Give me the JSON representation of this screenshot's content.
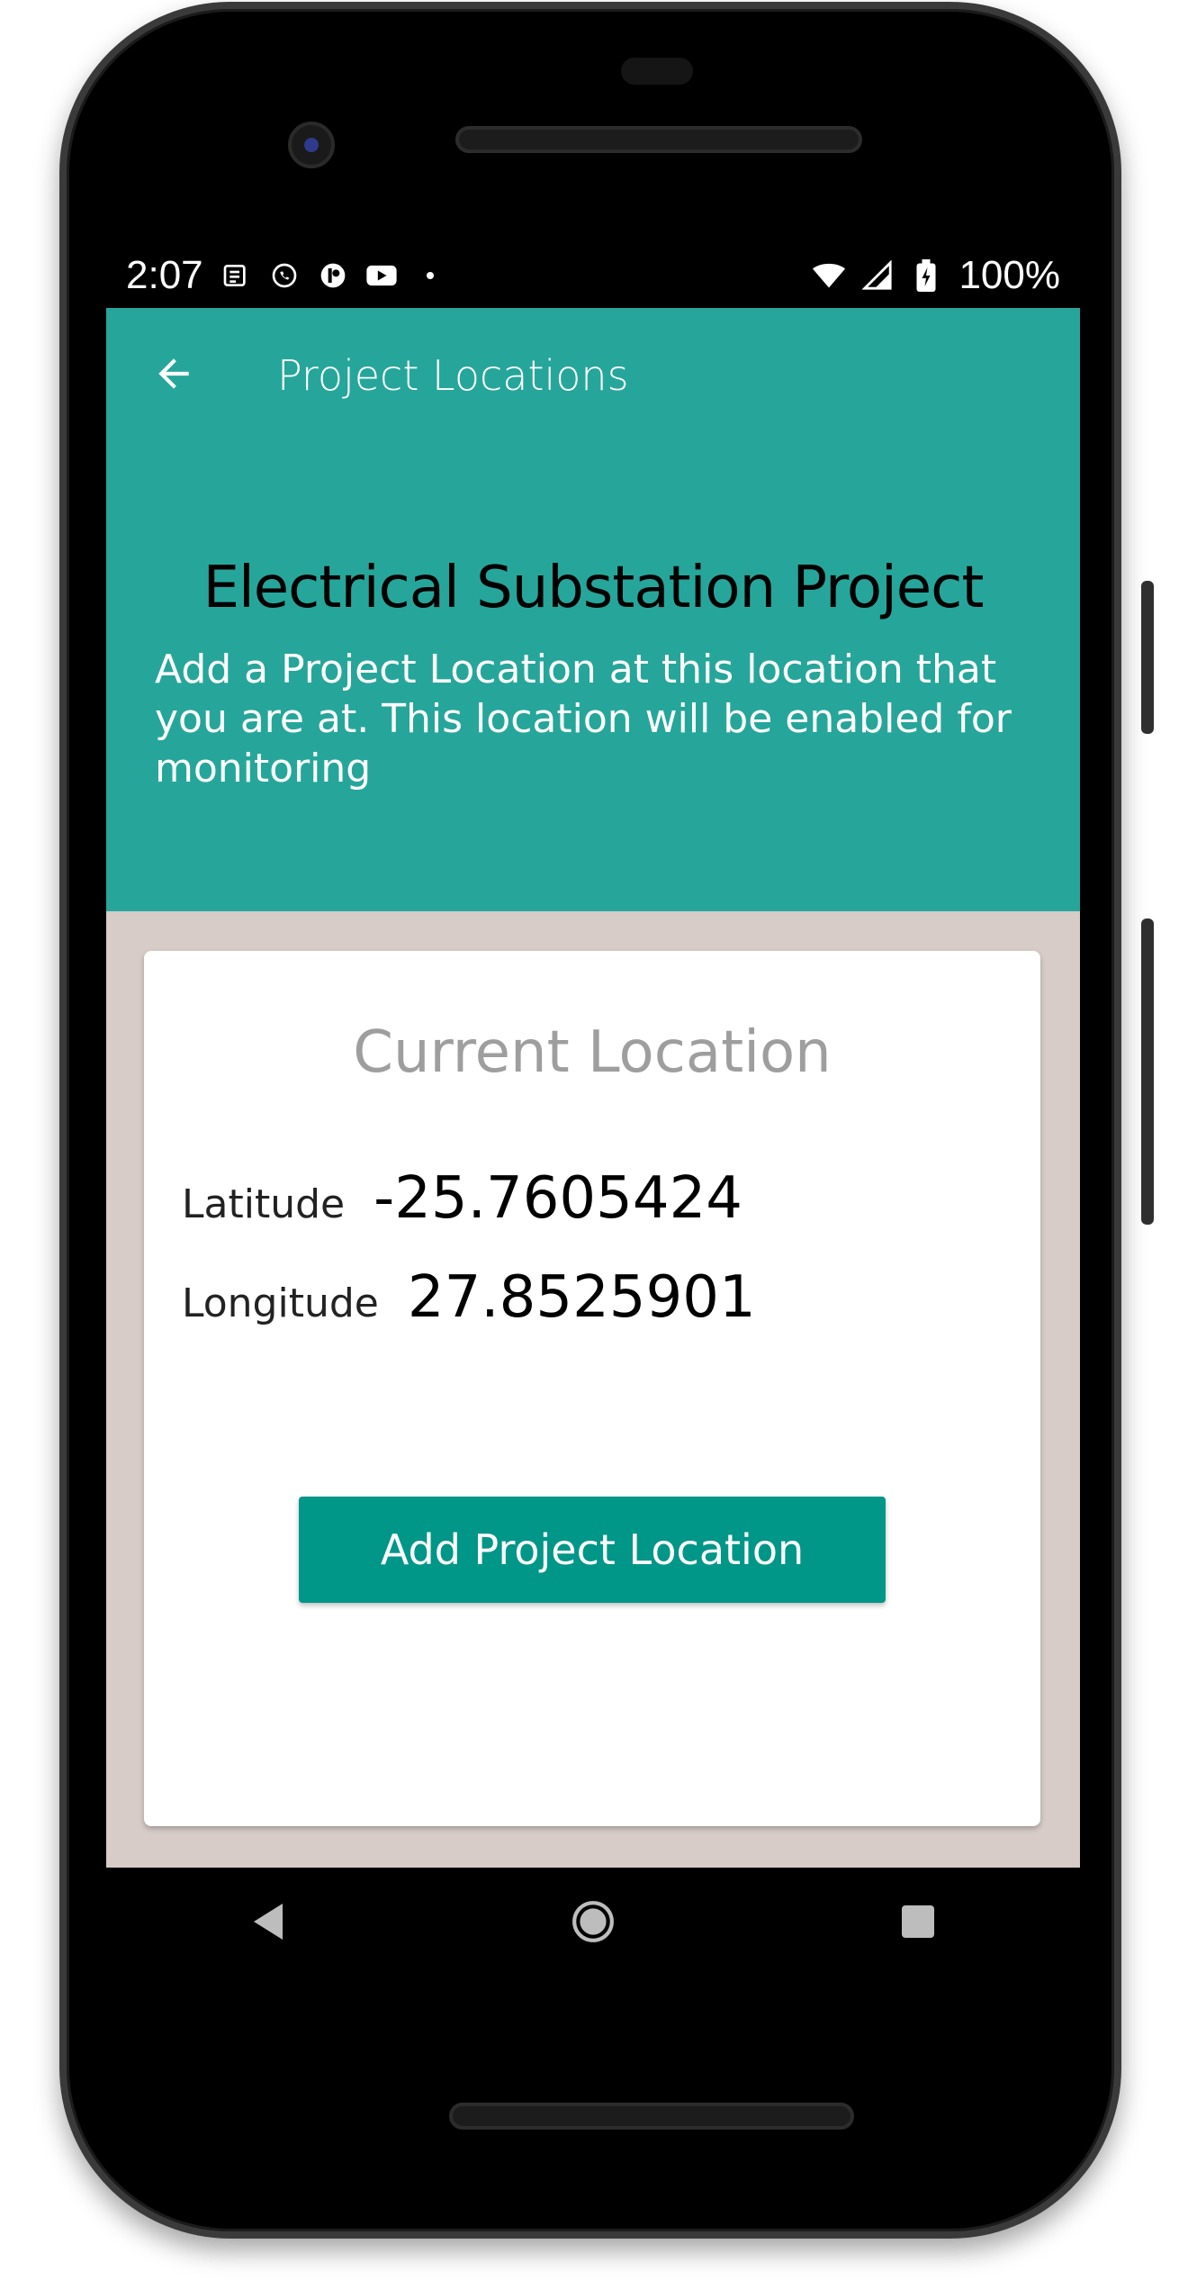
{
  "status_bar": {
    "time": "2:07",
    "notification_icons": [
      "news-icon",
      "whatsapp-icon",
      "app-icon",
      "youtube-icon",
      "dot-icon"
    ],
    "battery": "100%"
  },
  "app_bar": {
    "title": "Project Locations"
  },
  "header": {
    "project_name": "Electrical Substation Project",
    "description": "Add a Project Location at this location that you are at. This location will be enabled for monitoring"
  },
  "card": {
    "title": "Current Location",
    "latitude_label": "Latitude",
    "latitude_value": "-25.7605424",
    "longitude_label": "Longitude",
    "longitude_value": "27.8525901",
    "button_label": "Add Project Location"
  },
  "colors": {
    "primary": "#26a69a",
    "button": "#009688",
    "background": "#d7ccc8"
  }
}
